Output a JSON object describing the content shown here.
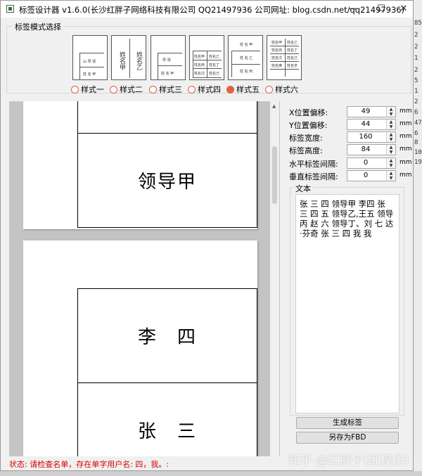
{
  "window": {
    "title": "标签设计器 v1.6.0(长沙红胖子网络科技有限公司 QQ21497936 公司网址: blog.csdn.net/qq21497936)",
    "minimize_glyph": "—",
    "maximize_glyph": "☐",
    "close_glyph": "✕"
  },
  "style_group": {
    "title": "标签模式选择",
    "options": [
      {
        "label": "样式一",
        "checked": false,
        "thumb_text": [
          "山 导 领",
          "姓 名 甲"
        ]
      },
      {
        "label": "样式二",
        "checked": false,
        "thumb_text": [
          "姓名甲",
          "姓名乙"
        ]
      },
      {
        "label": "样式三",
        "checked": false,
        "thumb_text": [
          "导 领",
          "姓 名 甲"
        ]
      },
      {
        "label": "样式四",
        "checked": false,
        "thumb_text": [
          "姓名甲",
          "姓名乙",
          "姓名丙",
          "姓名丁",
          "姓名戊",
          "姓名己"
        ]
      },
      {
        "label": "样式五",
        "checked": true,
        "thumb_text": [
          "姓 名 甲",
          "姓 名 乙",
          "姓 名 丙"
        ]
      },
      {
        "label": "样式六",
        "checked": false,
        "thumb_text": [
          "姓名甲",
          "姓名乙",
          "姓名丙",
          "姓名丁",
          "姓名戊",
          "姓名己",
          "姓名庚",
          "姓名辛"
        ]
      }
    ]
  },
  "preview": {
    "labels": [
      "领导甲",
      "李　四",
      "张　三"
    ]
  },
  "settings": {
    "x_offset": {
      "label": "X位置偏移:",
      "value": "49",
      "unit": "mm"
    },
    "y_offset": {
      "label": "Y位置偏移:",
      "value": "44",
      "unit": "mm"
    },
    "width": {
      "label": "标签宽度:",
      "value": "160",
      "unit": "mm"
    },
    "height": {
      "label": "标签高度:",
      "value": "84",
      "unit": "mm"
    },
    "h_gap": {
      "label": "水平标签间隔:",
      "value": "0",
      "unit": "mm"
    },
    "v_gap": {
      "label": "垂直标签间隔:",
      "value": "0",
      "unit": "mm"
    }
  },
  "text_panel": {
    "title": "文本",
    "content": "张 三 四 领导甲  李四 张 三 四 五  领导乙,王五 领导丙 赵 六  领导丁、刘 七  达·芬奇 张 三 四 我 我"
  },
  "buttons": {
    "generate": "生成标签",
    "save_as": "另存为FBD"
  },
  "status": "状态: 请检查名单，存在单字用户名: 四，我。:",
  "watermark": "知乎 @红胖子(红模仿)",
  "background_margin": [
    "85",
    "2",
    "2",
    "1",
    "2",
    "5",
    "1",
    "2",
    "6",
    "47",
    "6",
    "8",
    "10",
    "19"
  ]
}
